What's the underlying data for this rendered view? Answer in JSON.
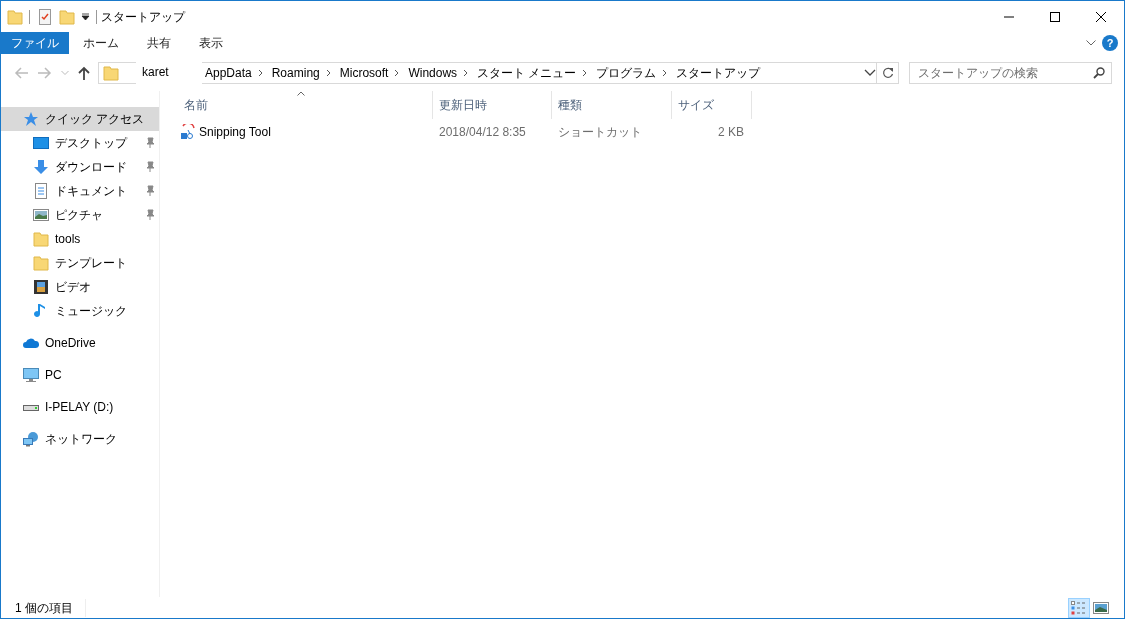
{
  "window": {
    "title": "スタートアップ"
  },
  "ribbon": {
    "tabs": [
      {
        "label": "ファイル",
        "selected": true
      },
      {
        "label": "ホーム",
        "selected": false
      },
      {
        "label": "共有",
        "selected": false
      },
      {
        "label": "表示",
        "selected": false
      }
    ],
    "help": "?"
  },
  "address": {
    "path": [
      "AppData",
      "Roaming",
      "Microsoft",
      "Windows",
      "スタート メニュー",
      "プログラム",
      "スタートアップ"
    ],
    "tooltip": "karet"
  },
  "search": {
    "placeholder": "スタートアップの検索"
  },
  "sidebar": {
    "items": [
      {
        "label": "クイック アクセス",
        "kind": "star",
        "selected": true,
        "children": [
          {
            "label": "デスクトップ",
            "kind": "desktop",
            "pinned": true,
            "selected": false
          },
          {
            "label": "ダウンロード",
            "kind": "download",
            "pinned": true,
            "selected": false
          },
          {
            "label": "ドキュメント",
            "kind": "document",
            "pinned": true,
            "selected": false
          },
          {
            "label": "ピクチャ",
            "kind": "pictures",
            "pinned": true,
            "selected": false
          },
          {
            "label": "tools",
            "kind": "folder",
            "pinned": false,
            "selected": false
          },
          {
            "label": "テンプレート",
            "kind": "folder",
            "pinned": false,
            "selected": false
          },
          {
            "label": "ビデオ",
            "kind": "video",
            "pinned": false,
            "selected": false
          },
          {
            "label": "ミュージック",
            "kind": "music",
            "pinned": false,
            "selected": false
          }
        ]
      },
      {
        "label": "OneDrive",
        "kind": "cloud",
        "selected": false
      },
      {
        "label": "PC",
        "kind": "pc",
        "selected": false
      },
      {
        "label": "I-PELAY (D:)",
        "kind": "drive",
        "selected": false
      },
      {
        "label": "ネットワーク",
        "kind": "network",
        "selected": false
      }
    ]
  },
  "table": {
    "columns": [
      {
        "label": "名前",
        "sorted": true
      },
      {
        "label": "更新日時",
        "sorted": false
      },
      {
        "label": "種類",
        "sorted": false
      },
      {
        "label": "サイズ",
        "sorted": false
      }
    ],
    "rows": [
      {
        "name": "Snipping Tool",
        "modified": "2018/04/12 8:35",
        "type": "ショートカット",
        "size": "2 KB"
      }
    ]
  },
  "status_bar": {
    "count": "1 個の項目",
    "views": [
      {
        "kind": "details",
        "selected": true
      },
      {
        "kind": "thumbnails",
        "selected": false
      }
    ]
  }
}
